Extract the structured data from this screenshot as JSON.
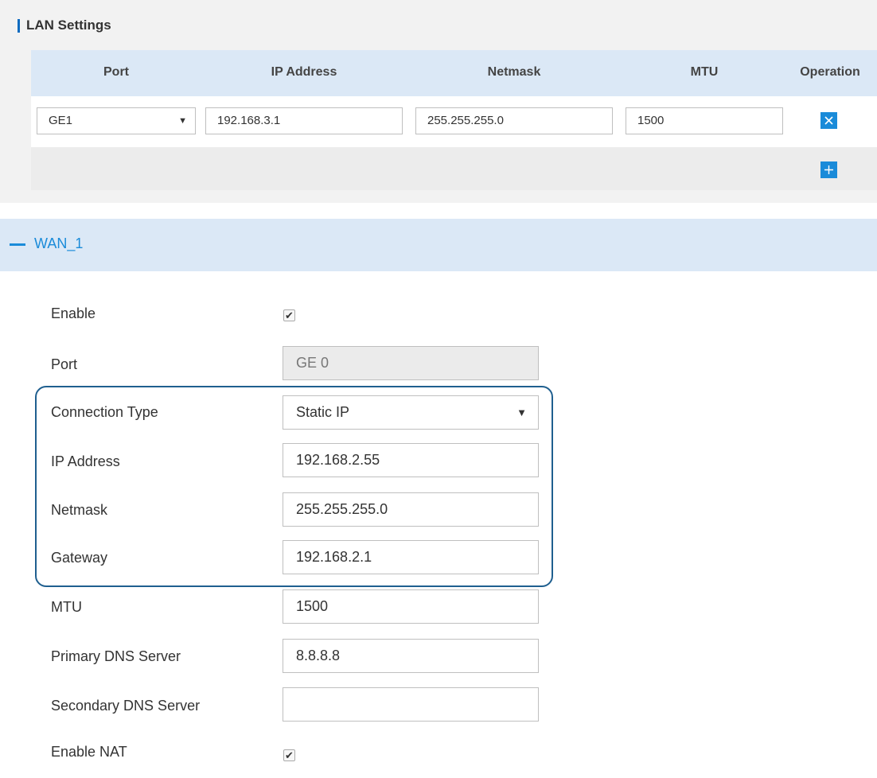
{
  "lan": {
    "title": "LAN Settings",
    "columns": [
      "Port",
      "IP Address",
      "Netmask",
      "MTU",
      "Operation"
    ],
    "row": {
      "port": "GE1",
      "ip": "192.168.3.1",
      "netmask": "255.255.255.0",
      "mtu": "1500"
    },
    "delete_icon": "×",
    "add_icon": "+"
  },
  "wan": {
    "title": "WAN_1",
    "labels": {
      "enable": "Enable",
      "port": "Port",
      "connection_type": "Connection Type",
      "ip_address": "IP Address",
      "netmask": "Netmask",
      "gateway": "Gateway",
      "mtu": "MTU",
      "primary_dns": "Primary DNS Server",
      "secondary_dns": "Secondary DNS Server",
      "enable_nat": "Enable NAT"
    },
    "values": {
      "enable_checked": "✔",
      "port": "GE 0",
      "connection_type": "Static IP",
      "ip_address": "192.168.2.55",
      "netmask": "255.255.255.0",
      "gateway": "192.168.2.1",
      "mtu": "1500",
      "primary_dns": "8.8.8.8",
      "secondary_dns": "",
      "enable_nat_checked": "✔"
    }
  },
  "colors": {
    "accent": "#1a8bd9",
    "header_bg": "#dbe8f6",
    "highlight_border": "#1f5f8f"
  }
}
